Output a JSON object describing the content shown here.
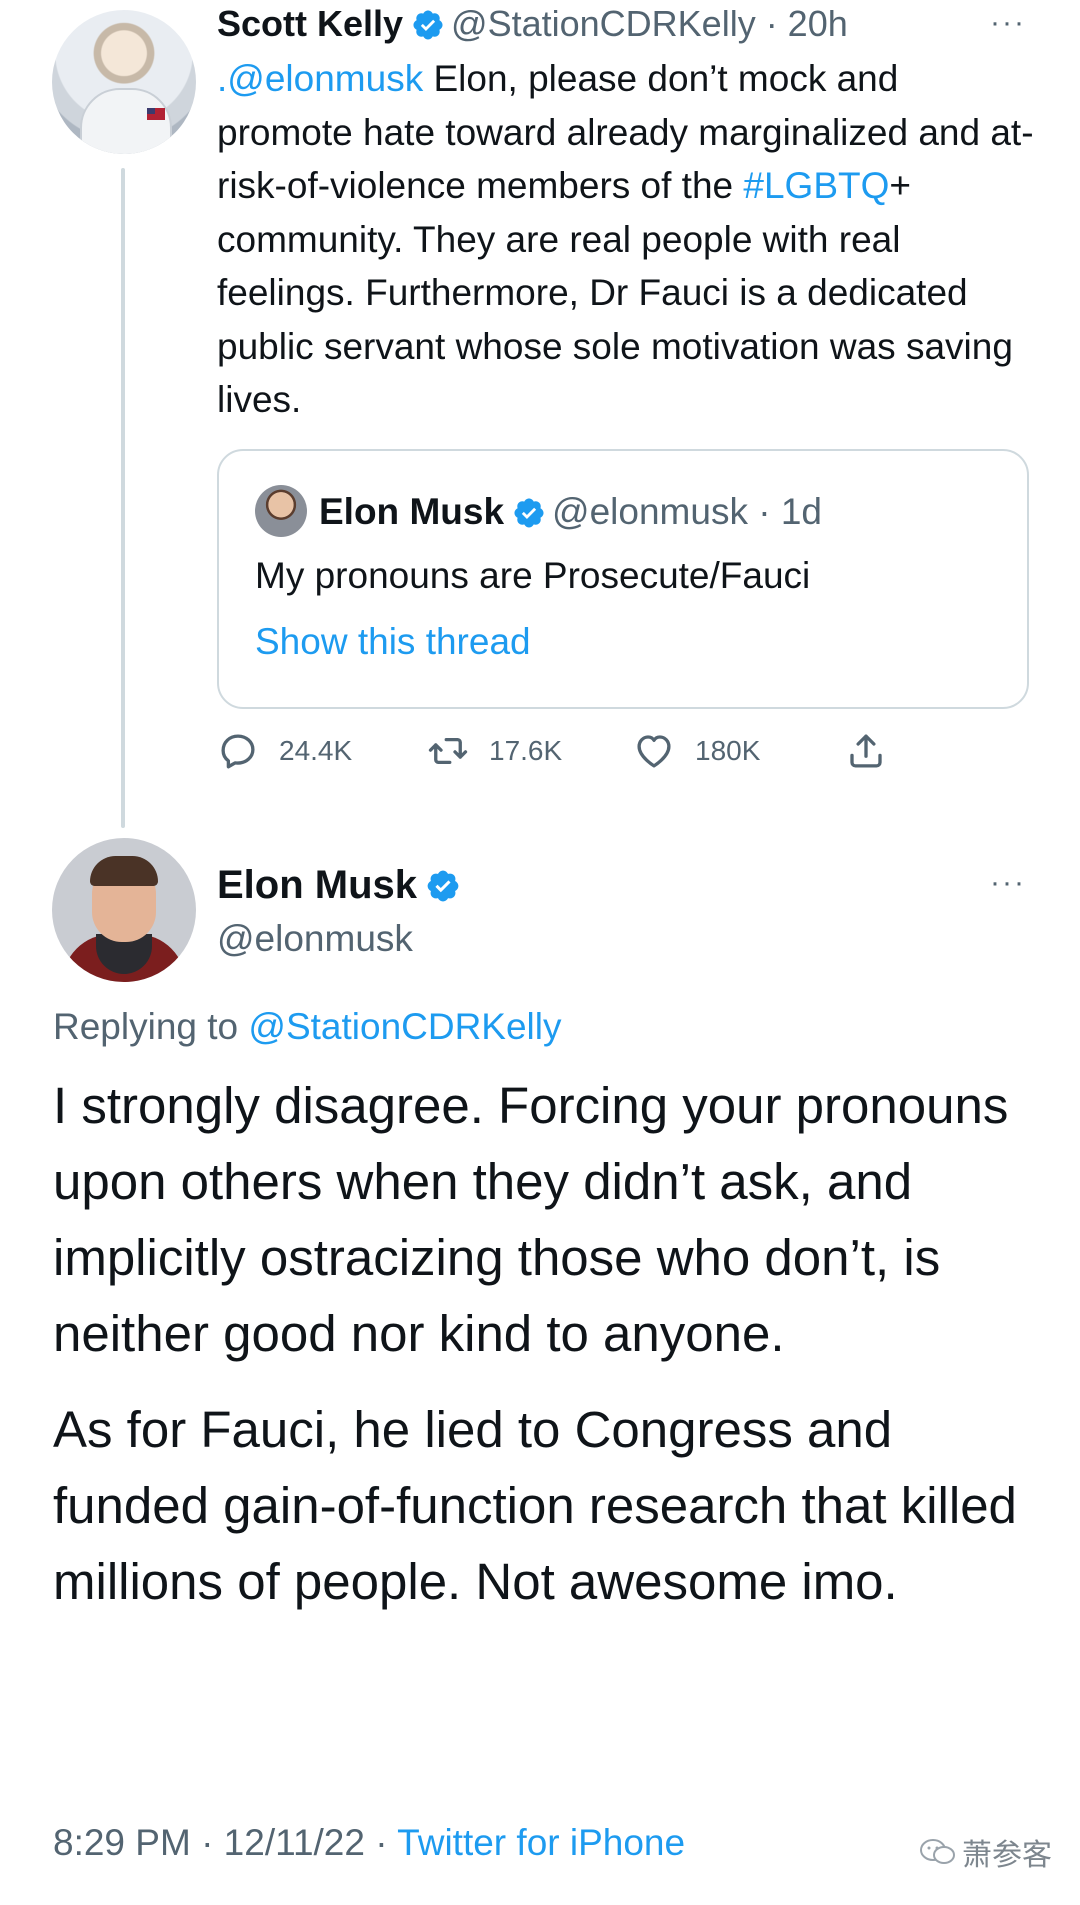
{
  "quoted_reply": {
    "author_name": "Scott Kelly",
    "handle_time": "@StationCDRKelly · 20h",
    "more_label": "···",
    "text_segments": [
      {
        "text": ".@elonmusk",
        "link": true
      },
      {
        "text": " Elon, please don’t mock and promote hate toward already marginalized and at-risk-of-violence members of the ",
        "link": false
      },
      {
        "text": "#LGBTQ",
        "link": true
      },
      {
        "text": "+ community. They are real people with real feelings. Furthermore, Dr Fauci is a dedicated public servant whose sole motivation was saving lives.",
        "link": false
      }
    ],
    "quote": {
      "author_name": "Elon Musk",
      "handle_time": "@elonmusk · 1d",
      "text": "My pronouns are Prosecute/Fauci",
      "link": "Show this thread"
    },
    "actions": {
      "replies": "24.4K",
      "retweets": "17.6K",
      "likes": "180K"
    }
  },
  "main_tweet": {
    "author_name": "Elon Musk",
    "handle": "@elonmusk",
    "more_label": "···",
    "replying_prefix": "Replying to ",
    "replying_to": "@StationCDRKelly",
    "paragraphs": [
      "I strongly disagree. Forcing your pronouns upon others when they didn’t ask, and implicitly ostracizing those who don’t, is neither good nor kind to anyone.",
      "As for Fauci, he lied to Congress and funded gain-of-function research that killed millions of people. Not awesome imo."
    ],
    "timestamp": "8:29 PM · 12/11/22 · ",
    "source": "Twitter for iPhone"
  },
  "watermark": "萧参客",
  "colors": {
    "link_blue": "#1d9bf0",
    "secondary_gray": "#536471",
    "border": "#cfd9de"
  }
}
